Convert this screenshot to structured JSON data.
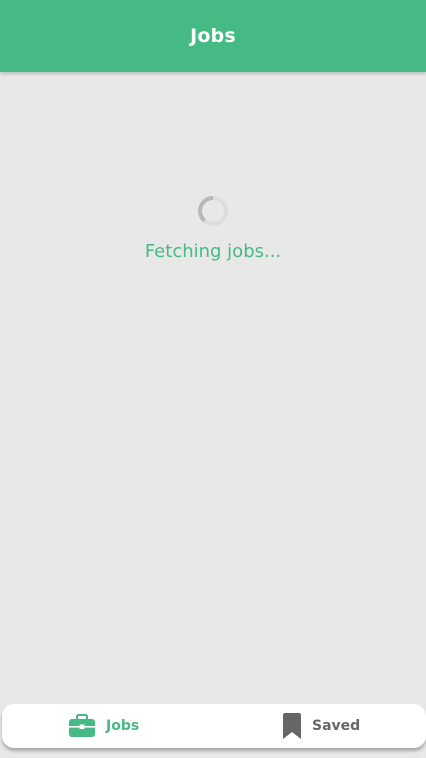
{
  "app_bar": {
    "title": "Jobs"
  },
  "loading": {
    "message": "Fetching jobs...",
    "icon": "spinner-icon"
  },
  "bottom_nav": {
    "items": [
      {
        "label": "Jobs",
        "icon": "briefcase-icon",
        "active": true
      },
      {
        "label": "Saved",
        "icon": "bookmark-icon",
        "active": false
      }
    ]
  },
  "colors": {
    "accent": "#45ba84",
    "background": "#e8e8e8",
    "inactive": "#666666"
  }
}
